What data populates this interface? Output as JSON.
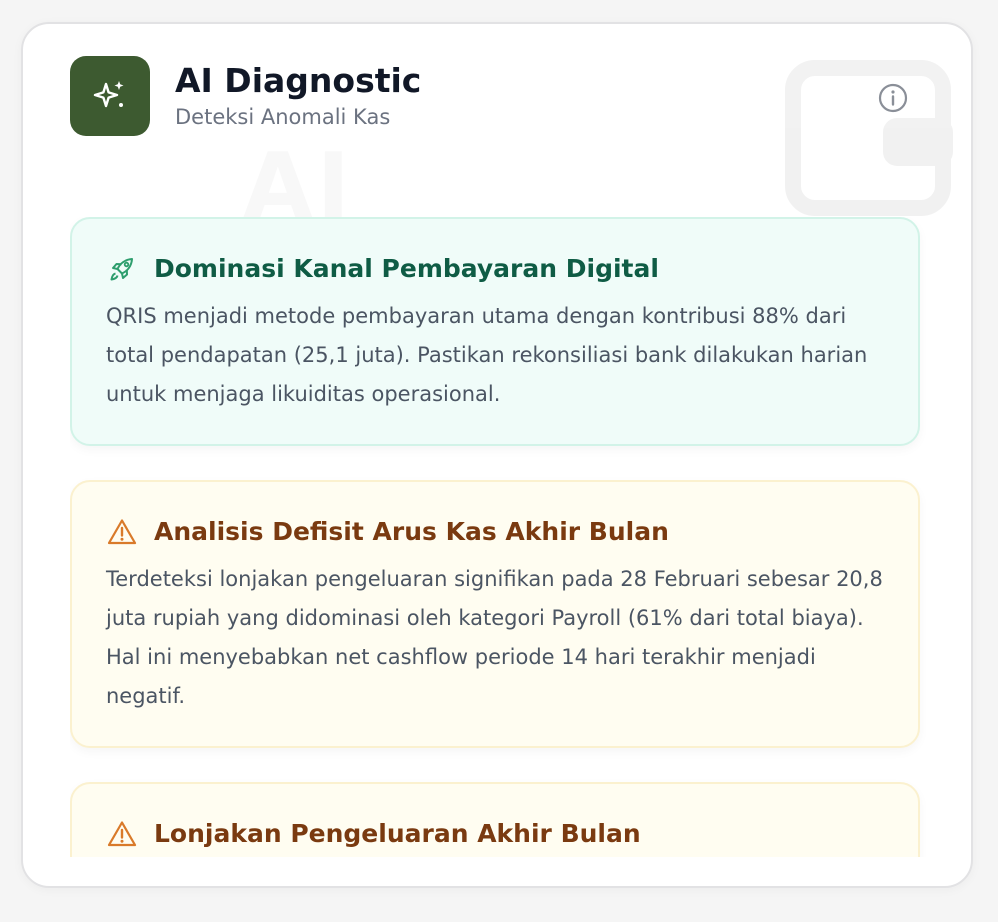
{
  "header": {
    "title": "AI Diagnostic",
    "subtitle": "Deteksi Anomali Kas",
    "app_icon": "sparkles-icon",
    "info_icon": "info-icon"
  },
  "colors": {
    "brand": "#3d5a30",
    "success_title": "#0f5c45",
    "warning_title": "#7a3a10",
    "warning_icon": "#d97a2a",
    "success_icon": "#2e9e6e"
  },
  "insights": [
    {
      "type": "success",
      "icon": "rocket-icon",
      "title": "Dominasi Kanal Pembayaran Digital",
      "body": "QRIS menjadi metode pembayaran utama dengan kontribusi 88% dari total pendapatan (25,1 juta). Pastikan rekonsiliasi bank dilakukan harian untuk menjaga likuiditas operasional."
    },
    {
      "type": "warning",
      "icon": "warning-triangle-icon",
      "title": "Analisis Defisit Arus Kas Akhir Bulan",
      "body": "Terdeteksi lonjakan pengeluaran signifikan pada 28 Februari sebesar 20,8 juta rupiah yang didominasi oleh kategori Payroll (61% dari total biaya). Hal ini menyebabkan net cashflow periode 14 hari terakhir menjadi negatif."
    },
    {
      "type": "warning",
      "icon": "warning-triangle-icon",
      "title": "Lonjakan Pengeluaran Akhir Bulan",
      "body": ""
    }
  ]
}
